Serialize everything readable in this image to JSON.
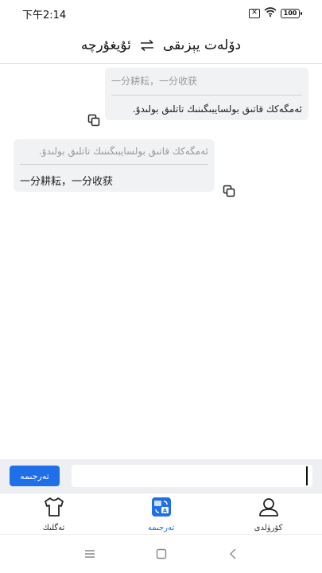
{
  "status_bar": {
    "time": "下午2:14",
    "sim_icon": "sim-off-icon",
    "wifi_icon": "wifi-icon",
    "battery": "100"
  },
  "header": {
    "source_lang": "دۆلەت يېزىقى",
    "target_lang": "ئۇيغۇرچە",
    "swap_icon": "swap-arrows-icon"
  },
  "messages": [
    {
      "source_text": "一分耕耘，一分收获",
      "translated_text": "ئەمگەكك قاتىق بولسايبىگىنىك تاتلىق بولىدۇ."
    },
    {
      "source_text": "ئەمگەكك قاتىق بولسايبىگىنىك تاتلىق بولىدۇ.",
      "translated_text": "一分耕耘，一分收获"
    }
  ],
  "input_bar": {
    "translate_button_label": "تەرجىمە",
    "input_value": "",
    "input_placeholder": ""
  },
  "bottom_nav": [
    {
      "label": "تەگلىك",
      "icon": "shirt-icon",
      "active": false
    },
    {
      "label": "تەرجىمە",
      "icon": "translate-icon",
      "active": true
    },
    {
      "label": "كۆرۈلدى",
      "icon": "profile-icon",
      "active": false
    }
  ],
  "colors": {
    "accent": "#1e6fe8",
    "bubble_bg": "#f1f2f4",
    "input_bar_bg": "#eeeff2"
  }
}
